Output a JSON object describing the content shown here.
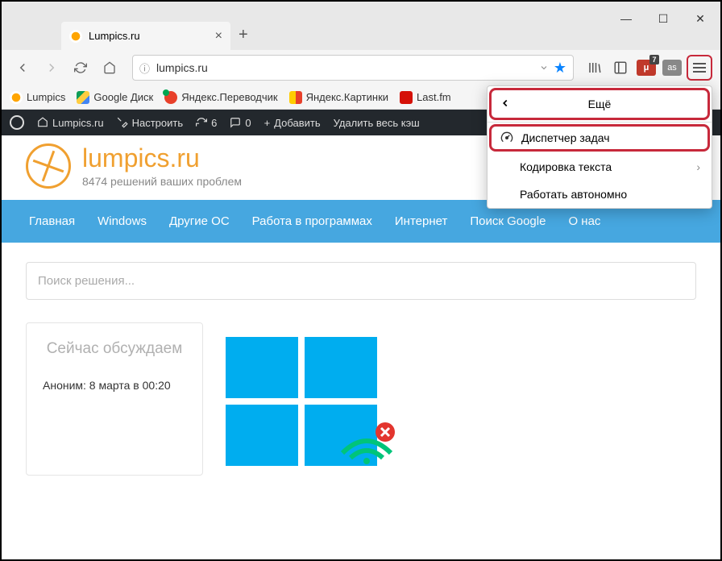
{
  "window": {
    "min": "—",
    "max": "☐",
    "close": "✕"
  },
  "tab": {
    "title": "Lumpics.ru"
  },
  "url": {
    "value": "lumpics.ru",
    "info_icon": "ⓘ"
  },
  "toolbar_ext": {
    "badge_count": "7",
    "ublock": "μ",
    "lastfm": "as"
  },
  "bookmarks": [
    {
      "label": "Lumpics"
    },
    {
      "label": "Google Диск"
    },
    {
      "label": "Яндекс.Переводчик"
    },
    {
      "label": "Яндекс.Картинки"
    },
    {
      "label": "Last.fm"
    }
  ],
  "wpbar": {
    "site": "Lumpics.ru",
    "customize": "Настроить",
    "updates": "6",
    "comments": "0",
    "add": "Добавить",
    "clear": "Удалить весь кэш"
  },
  "page": {
    "title": "lumpics.ru",
    "subtitle": "8474 решений ваших проблем",
    "nav": [
      "Главная",
      "Windows",
      "Другие ОС",
      "Работа в программах",
      "Интернет",
      "Поиск Google",
      "О нас"
    ],
    "search_placeholder": "Поиск решения...",
    "card_title": "Сейчас обсуждаем",
    "card_meta": "Аноним: 8 марта в 00:20"
  },
  "menu": {
    "header": "Ещё",
    "task_manager": "Диспетчер задач",
    "encoding": "Кодировка текста",
    "offline": "Работать автономно"
  }
}
